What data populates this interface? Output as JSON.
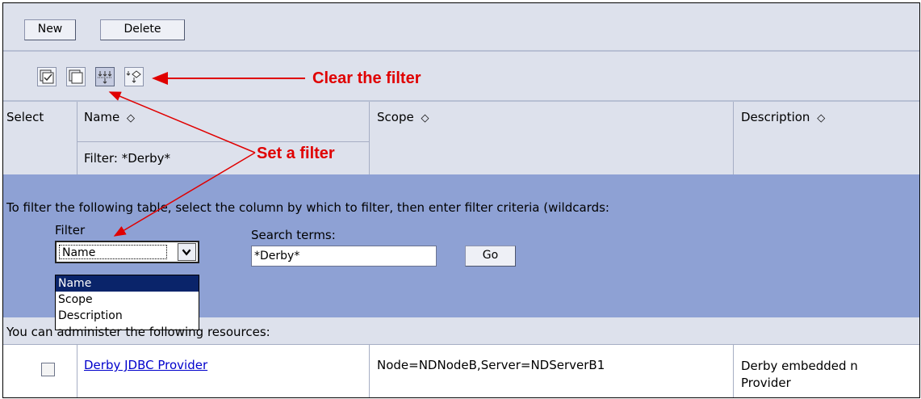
{
  "toolbar": {
    "new_label": "New",
    "delete_label": "Delete"
  },
  "icons": [
    "select-all-icon",
    "deselect-all-icon",
    "show-filter-icon",
    "clear-filter-icon"
  ],
  "table": {
    "headers": {
      "select": "Select",
      "name": "Name",
      "scope": "Scope",
      "description": "Description",
      "sort_glyph": "◇"
    },
    "active_filter": "Filter: *Derby*",
    "resources_caption": "You can administer the following resources:",
    "rows": [
      {
        "name": "Derby JDBC Provider",
        "scope": "Node=NDNodeB,Server=NDServerB1",
        "description_line1": "Derby embedded n",
        "description_line2": "Provider"
      }
    ]
  },
  "filter_panel": {
    "instructions": "To filter the following table, select the column by which to filter, then enter filter criteria (wildcards: ",
    "filter_label": "Filter",
    "selected": "Name",
    "options": [
      "Name",
      "Scope",
      "Description"
    ],
    "search_label": "Search terms:",
    "search_value": "*Derby*",
    "go_label": "Go"
  },
  "annotations": {
    "clear_filter": "Clear the filter",
    "set_filter": "Set a filter"
  },
  "colors": {
    "annotation": "#e00000",
    "panel_bg": "#dde1ec",
    "filter_bg": "#8ea1d4",
    "selected_option": "#0a246a"
  }
}
